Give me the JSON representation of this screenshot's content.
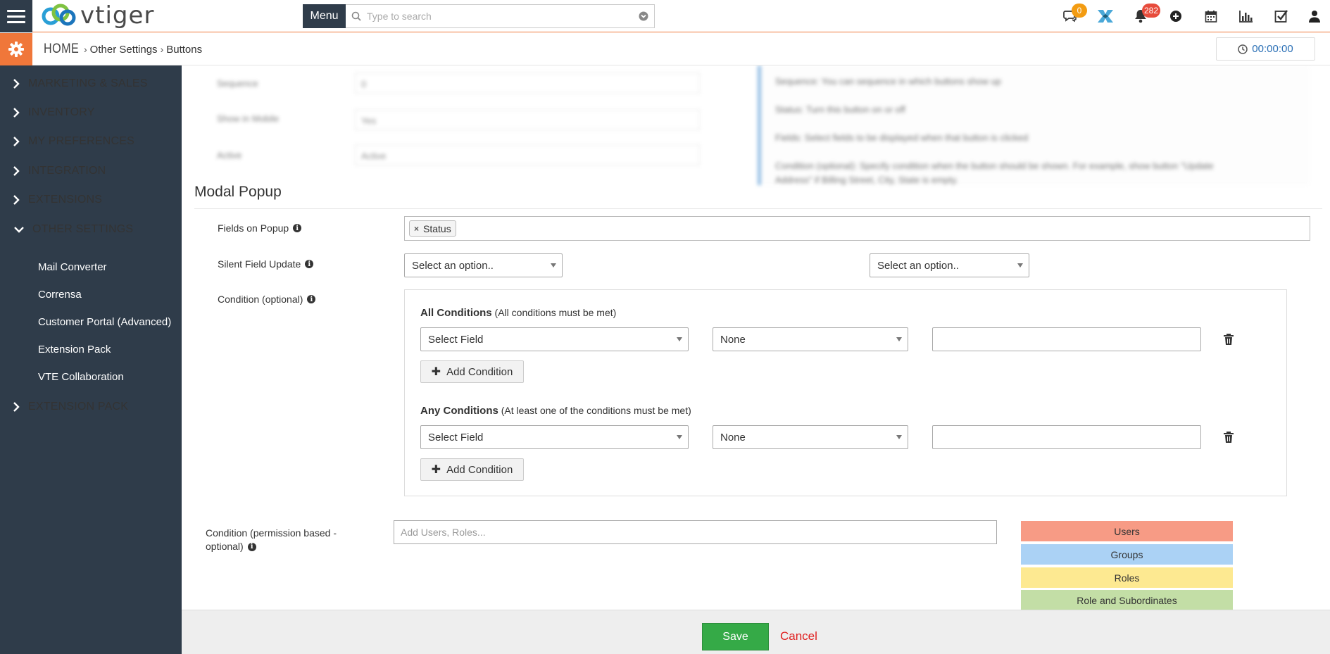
{
  "app": {
    "logo_text": "vtiger",
    "menu_label": "Menu",
    "search_placeholder": "Type to search"
  },
  "topbar": {
    "chat_badge": "0",
    "notifications_badge": "282"
  },
  "breadcrumb": {
    "home": "HOME",
    "level1": "Other Settings",
    "level2": "Buttons"
  },
  "timer": "00:00:00",
  "sidebar": {
    "sections": [
      {
        "label": "MARKETING & SALES"
      },
      {
        "label": "INVENTORY"
      },
      {
        "label": "MY PREFERENCES"
      },
      {
        "label": "INTEGRATION"
      },
      {
        "label": "EXTENSIONS"
      },
      {
        "label": "OTHER SETTINGS"
      },
      {
        "label": "EXTENSION PACK"
      }
    ],
    "other_settings_items": [
      "Mail Converter",
      "Corrensa",
      "Customer Portal (Advanced)",
      "Extension Pack",
      "VTE Collaboration"
    ]
  },
  "blurred_form": {
    "fields": [
      {
        "label": "Sequence",
        "value": "0"
      },
      {
        "label": "Show in Mobile",
        "value": "Yes"
      },
      {
        "label": "Active",
        "value": "Active"
      }
    ],
    "help": [
      "Sequence: You can sequence in which buttons show up",
      "Status: Turn this button on or off",
      "Fields: Select fields to be displayed when that button is clicked",
      "Condition (optional): Specify condition when the button should be shown. For example, show button \"Update",
      "Address\" if Billing Street, City, State is empty."
    ]
  },
  "modal_popup": {
    "title": "Modal Popup",
    "fields_on_popup_label": "Fields on Popup",
    "fields_on_popup_tags": [
      "Status"
    ],
    "silent_field_update_label": "Silent Field Update",
    "silent_select_1": "Select an option..",
    "silent_select_2": "Select an option..",
    "condition_label": "Condition (optional)",
    "all_conditions": {
      "title": "All Conditions",
      "subtitle": "(All conditions must be met)",
      "field_select": "Select Field",
      "operator_select": "None",
      "add_label": "Add Condition"
    },
    "any_conditions": {
      "title": "Any Conditions",
      "subtitle": "(At least one of the conditions must be met)",
      "field_select": "Select Field",
      "operator_select": "None",
      "add_label": "Add Condition"
    },
    "permission_label_line1": "Condition (permission based -",
    "permission_label_line2": "optional)",
    "permission_placeholder": "Add Users, Roles...",
    "legend": [
      {
        "label": "Users",
        "color": "#f79b85"
      },
      {
        "label": "Groups",
        "color": "#abd2f5"
      },
      {
        "label": "Roles",
        "color": "#fde991"
      },
      {
        "label": "Role and Subordinates",
        "color": "#c3dea6"
      }
    ]
  },
  "footer": {
    "save_label": "Save",
    "cancel_label": "Cancel"
  }
}
